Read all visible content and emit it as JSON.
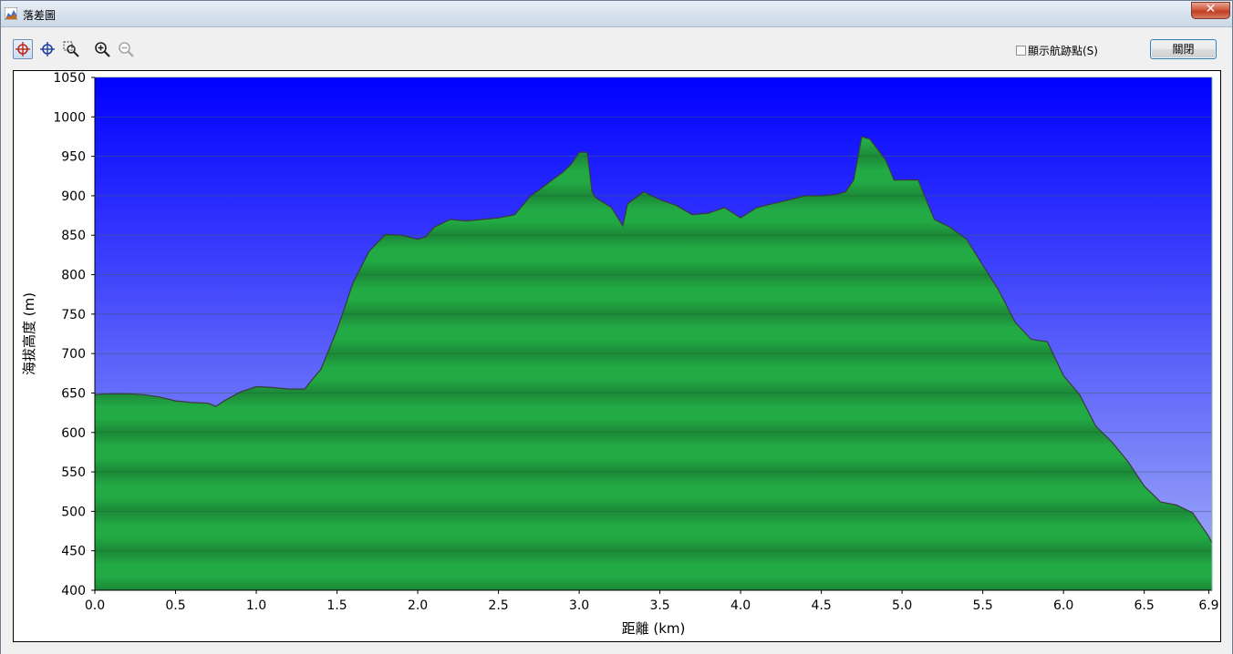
{
  "window": {
    "title": "落差圖",
    "close_glyph": "✕"
  },
  "toolbar": {
    "tools": [
      {
        "icon": "crosshair-red-icon",
        "active": true
      },
      {
        "icon": "crosshair-blue-icon",
        "active": false
      },
      {
        "icon": "zoom-box-icon",
        "active": false
      },
      {
        "icon": "zoom-in-icon",
        "active": false
      },
      {
        "icon": "zoom-out-icon",
        "active": false,
        "disabled": true
      }
    ],
    "show_points_label": "顯示航跡點(S)",
    "show_points_checked": false,
    "close_button_label": "關閉"
  },
  "colors": {
    "sky_top": "#0000ff",
    "sky_bottom": "#a6b1f6",
    "terrain_light": "#22aa44",
    "terrain_dark": "#1c8838",
    "outline": "#3a3a3a",
    "grid": "#5566aa"
  },
  "chart_data": {
    "type": "area",
    "title": "",
    "xlabel": "距離  (km)",
    "ylabel": "海拔高度 (m)",
    "xlim": [
      0.0,
      6.92
    ],
    "ylim": [
      400,
      1050
    ],
    "x_ticks": [
      "0.0",
      "0.5",
      "1.0",
      "1.5",
      "2.0",
      "2.5",
      "3.0",
      "3.5",
      "4.0",
      "4.5",
      "5.0",
      "5.5",
      "6.0",
      "6.5",
      "6.9"
    ],
    "x_tick_values": [
      0.0,
      0.5,
      1.0,
      1.5,
      2.0,
      2.5,
      3.0,
      3.5,
      4.0,
      4.5,
      5.0,
      5.5,
      6.0,
      6.5,
      6.9
    ],
    "y_ticks": [
      "400",
      "450",
      "500",
      "550",
      "600",
      "650",
      "700",
      "750",
      "800",
      "850",
      "900",
      "950",
      "1000",
      "1050"
    ],
    "y_tick_values": [
      400,
      450,
      500,
      550,
      600,
      650,
      700,
      750,
      800,
      850,
      900,
      950,
      1000,
      1050
    ],
    "grid": true,
    "x": [
      0.0,
      0.1,
      0.2,
      0.3,
      0.4,
      0.5,
      0.6,
      0.7,
      0.75,
      0.8,
      0.9,
      1.0,
      1.1,
      1.2,
      1.3,
      1.35,
      1.4,
      1.5,
      1.55,
      1.6,
      1.7,
      1.8,
      1.9,
      2.0,
      2.05,
      2.1,
      2.2,
      2.3,
      2.4,
      2.5,
      2.6,
      2.7,
      2.75,
      2.8,
      2.9,
      2.95,
      3.0,
      3.05,
      3.08,
      3.1,
      3.2,
      3.27,
      3.3,
      3.4,
      3.5,
      3.6,
      3.7,
      3.8,
      3.9,
      4.0,
      4.1,
      4.2,
      4.3,
      4.4,
      4.5,
      4.6,
      4.65,
      4.7,
      4.75,
      4.8,
      4.9,
      4.95,
      5.0,
      5.1,
      5.2,
      5.3,
      5.4,
      5.5,
      5.6,
      5.7,
      5.8,
      5.9,
      6.0,
      6.1,
      6.2,
      6.3,
      6.4,
      6.5,
      6.6,
      6.7,
      6.8,
      6.9,
      6.92
    ],
    "y": [
      648,
      649,
      649,
      648,
      645,
      640,
      638,
      637,
      633,
      640,
      651,
      658,
      657,
      655,
      655,
      668,
      680,
      730,
      760,
      790,
      830,
      851,
      850,
      845,
      848,
      860,
      870,
      868,
      870,
      872,
      876,
      900,
      907,
      915,
      930,
      940,
      955,
      955,
      905,
      898,
      885,
      862,
      890,
      905,
      895,
      888,
      876,
      878,
      885,
      872,
      885,
      890,
      895,
      900,
      900,
      902,
      905,
      920,
      975,
      972,
      945,
      920,
      920,
      920,
      870,
      860,
      845,
      812,
      780,
      740,
      718,
      715,
      672,
      648,
      608,
      588,
      563,
      532,
      512,
      508,
      498,
      468,
      460
    ]
  }
}
